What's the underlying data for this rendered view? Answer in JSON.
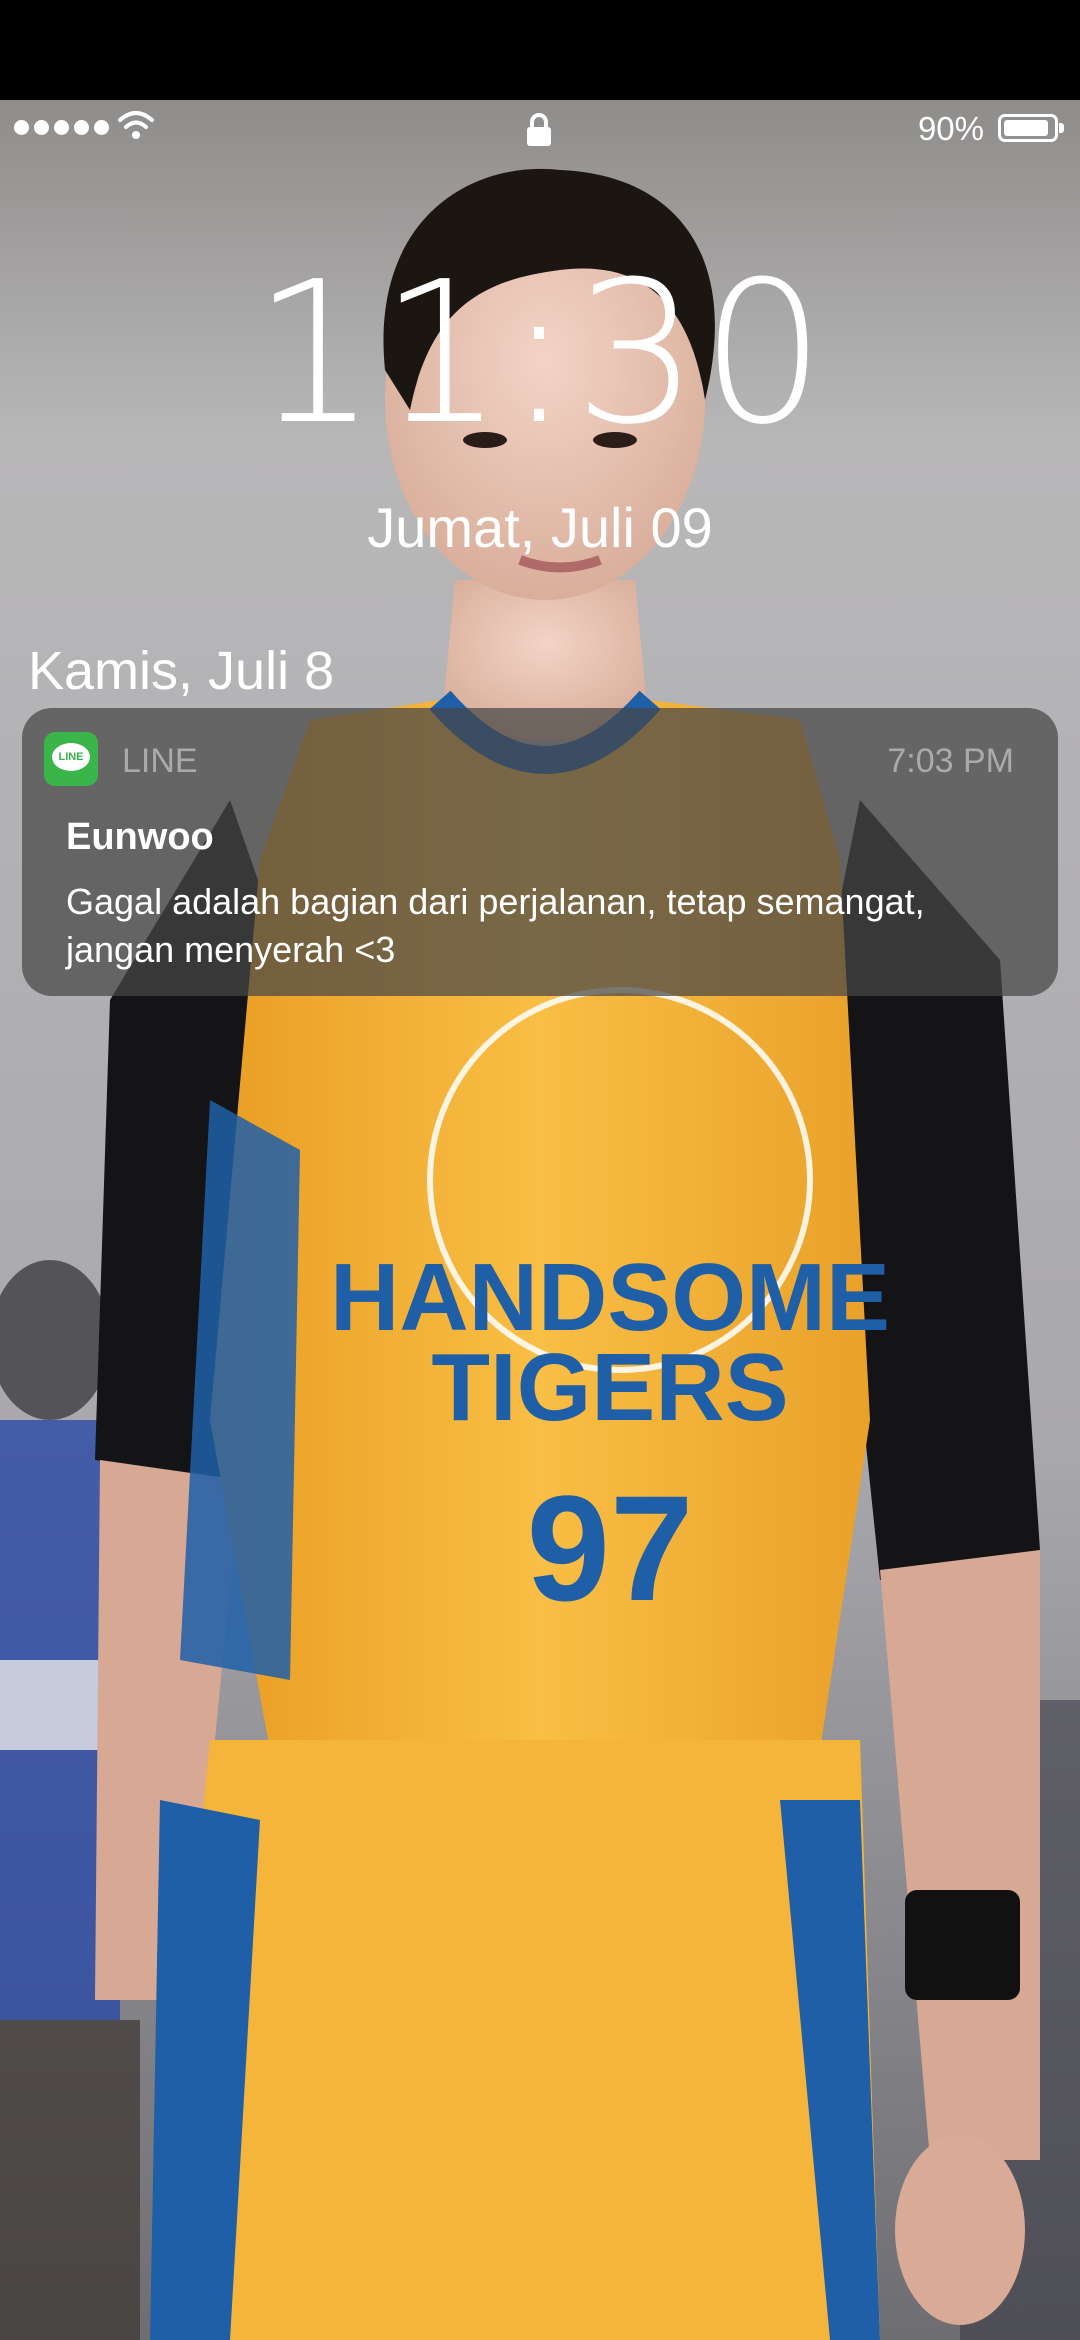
{
  "status_bar": {
    "signal_dots": 5,
    "battery_percent": "90%",
    "battery_level": 0.9
  },
  "lock_screen": {
    "time": "11:30",
    "date": "Jumat, Juli 09",
    "group_date": "Kamis, Juli 8"
  },
  "notification": {
    "app_name": "LINE",
    "app_icon_text": "LINE",
    "time": "7:03 PM",
    "sender": "Eunwoo",
    "message": "Gagal adalah bagian dari perjalanan, tetap semangat, jangan menyerah <3",
    "app_color": "#39b54a"
  },
  "wallpaper": {
    "jersey_text_line1": "HANDSOME",
    "jersey_text_line2": "TIGERS",
    "jersey_number": "97",
    "jersey_color": "#f5b43a",
    "trim_color": "#1f5fa8"
  }
}
